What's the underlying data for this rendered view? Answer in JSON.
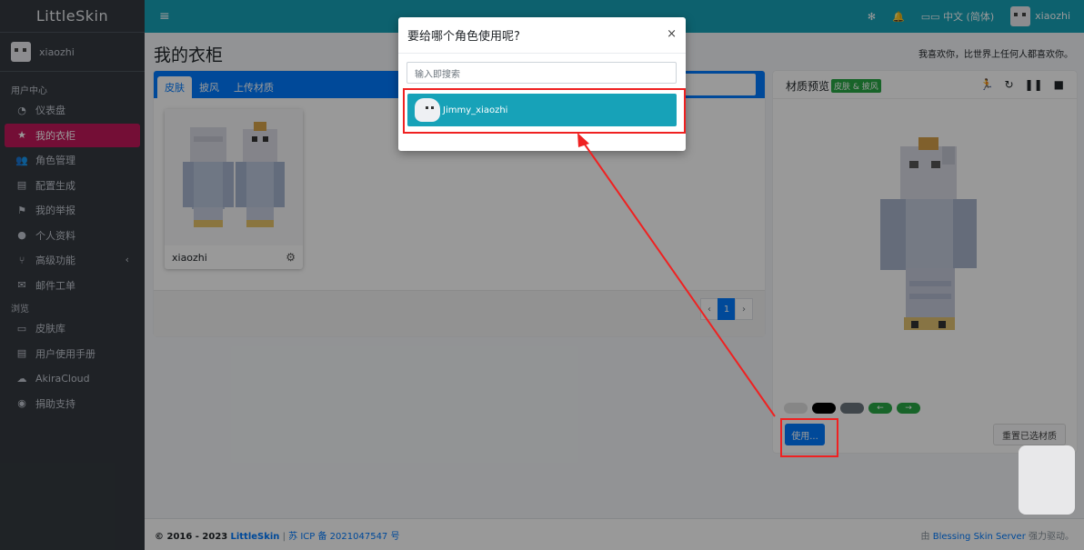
{
  "brand": "LittleSkin",
  "sidebar": {
    "user_name": "xiaozhi",
    "section_user": "用户中心",
    "section_browse": "浏览",
    "items": [
      {
        "label": "仪表盘",
        "icon": "tachometer-icon"
      },
      {
        "label": "我的衣柜",
        "icon": "star-icon",
        "active": true
      },
      {
        "label": "角色管理",
        "icon": "users-icon"
      },
      {
        "label": "配置生成",
        "icon": "book-icon"
      },
      {
        "label": "我的举报",
        "icon": "flag-icon"
      },
      {
        "label": "个人资料",
        "icon": "user-icon"
      },
      {
        "label": "高级功能",
        "icon": "code-branch-icon"
      },
      {
        "label": "邮件工单",
        "icon": "envelope-icon"
      }
    ],
    "browse_items": [
      {
        "label": "皮肤库",
        "icon": "archive-icon"
      },
      {
        "label": "用户使用手册",
        "icon": "book-icon"
      },
      {
        "label": "AkiraCloud",
        "icon": "cloud-icon"
      },
      {
        "label": "捐助支持",
        "icon": "donate-icon"
      }
    ]
  },
  "topbar": {
    "language": "中文 (简体)",
    "user_name": "xiaozhi"
  },
  "page": {
    "title": "我的衣柜",
    "welcome": "我喜欢你，比世界上任何人都喜欢你。"
  },
  "wardrobe": {
    "tabs": [
      "皮肤",
      "披风",
      "上传材质"
    ],
    "item_name": "xiaozhi",
    "pages": [
      "1"
    ]
  },
  "preview": {
    "title": "材质预览",
    "badge": "皮肤 & 披风",
    "use_button": "使用...",
    "reset_button": "重置已选材质",
    "bg_colors": [
      "#e0e0e0",
      "#000000",
      "#6c757d",
      "#28a745",
      "#28a745"
    ]
  },
  "modal": {
    "title": "要给哪个角色使用呢?",
    "search_placeholder": "输入即搜索",
    "close": "×",
    "player": "Jimmy_xiaozhi"
  },
  "footer": {
    "copyright_prefix": "© 2016 - 2023",
    "site": "LittleSkin",
    "icp": "苏 ICP 备 2021047547 号",
    "powered_prefix": "由",
    "powered_link": "Blessing Skin Server",
    "powered_suffix": "强力驱动。"
  },
  "colors": {
    "accent": "#17a2b8",
    "primary": "#007bff",
    "active_nav": "#c2185b",
    "annotation": "#ef2121"
  }
}
